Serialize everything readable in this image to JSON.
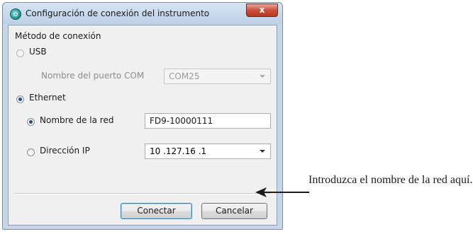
{
  "window": {
    "title": "Configuración de conexión del instrumento",
    "close_glyph": "x"
  },
  "section": {
    "label": "Método de conexión"
  },
  "usb": {
    "label": "USB",
    "checked": false,
    "com_label": "Nombre del puerto COM",
    "com_value": "COM25"
  },
  "ethernet": {
    "label": "Ethernet",
    "checked": true,
    "network_name_label": "Nombre de la red",
    "network_name_value": "FD9-10000111",
    "network_name_checked": true,
    "ip_label": "Dirección IP",
    "ip_value": "10 .127.16 .1",
    "ip_checked": false
  },
  "buttons": {
    "connect": "Conectar",
    "cancel": "Cancelar"
  },
  "annotation": {
    "text": "Introduzca el nombre de la red aquí."
  }
}
